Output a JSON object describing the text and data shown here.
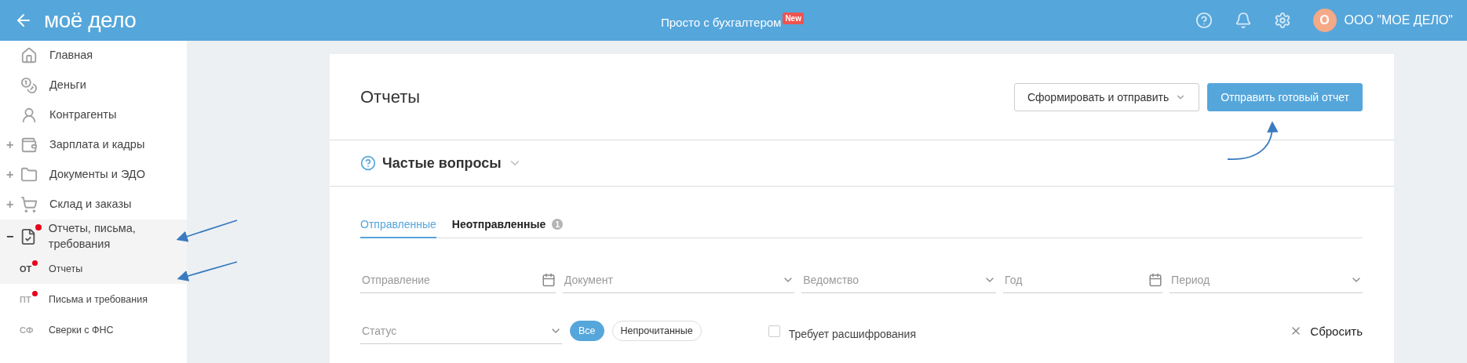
{
  "header": {
    "logo": "моё дело",
    "promo": "Просто с бухгалтером",
    "promo_badge": "New",
    "avatar": "О",
    "company": "ООО \"МОЕ ДЕЛО\""
  },
  "sidebar": {
    "items": [
      {
        "label": "Главная",
        "selected": false,
        "notify": false
      },
      {
        "label": "Деньги",
        "selected": false,
        "notify": false
      },
      {
        "label": "Контрагенты",
        "selected": false,
        "notify": false
      },
      {
        "label": "Зарплата и кадры",
        "selected": false,
        "notify": false,
        "toggle": "+",
        "expanded": false
      },
      {
        "label": "Документы и ЭДО",
        "selected": false,
        "notify": false,
        "toggle": "+",
        "expanded": false
      },
      {
        "label": "Склад и заказы",
        "selected": false,
        "notify": false,
        "toggle": "+",
        "expanded": false
      },
      {
        "label": "Отчеты, письма, требования",
        "selected": true,
        "notify": true,
        "toggle": "−",
        "expanded": true,
        "children": [
          {
            "abbr": "ОТ",
            "label": "Отчеты",
            "selected": true,
            "notify": true
          },
          {
            "abbr": "ПТ",
            "label": "Письма и требования",
            "selected": false,
            "notify": true
          },
          {
            "abbr": "СФ",
            "label": "Сверки с ФНС",
            "selected": false,
            "notify": false
          }
        ]
      }
    ]
  },
  "page": {
    "title": "Отчеты",
    "buttons": [
      {
        "label": "Сформировать и отправить",
        "kind": "dropdown"
      },
      {
        "label": "Отправить готовый отчет",
        "kind": "primary"
      }
    ],
    "faq": {
      "label": "Частые вопросы",
      "expanded": false
    },
    "tabs": [
      {
        "label": "Отправленные",
        "selected": true
      },
      {
        "label": "Неотправленные",
        "selected": false,
        "count": "1"
      }
    ],
    "filters": [
      {
        "placeholder": "Отправление",
        "kind": "date"
      },
      {
        "placeholder": "Документ",
        "kind": "select"
      },
      {
        "placeholder": "Ведомство",
        "kind": "select"
      },
      {
        "placeholder": "Год",
        "kind": "date"
      },
      {
        "placeholder": "Период",
        "kind": "select"
      }
    ],
    "status": {
      "placeholder": "Статус"
    },
    "toggles": [
      {
        "label": "Все",
        "selected": true
      },
      {
        "label": "Непрочитанные",
        "selected": false
      }
    ],
    "checkbox": {
      "label": "Требует расшифрования",
      "checked": false
    },
    "reset": "Сбросить"
  }
}
